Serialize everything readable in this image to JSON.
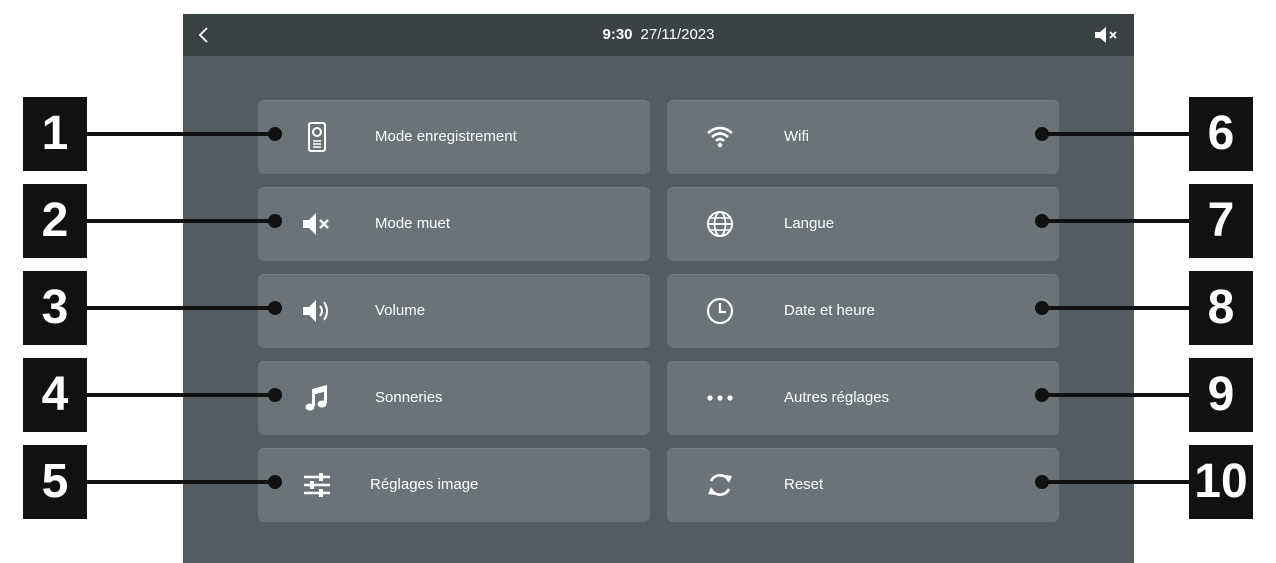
{
  "status": {
    "time": "9:30",
    "date": "27/11/2023"
  },
  "tiles": [
    {
      "label": "Mode enregistrement",
      "icon": "intercom-icon"
    },
    {
      "label": "Mode muet",
      "icon": "mute-icon"
    },
    {
      "label": "Volume",
      "icon": "volume-icon"
    },
    {
      "label": "Sonneries",
      "icon": "music-note-icon"
    },
    {
      "label": "Réglages image",
      "icon": "sliders-icon"
    },
    {
      "label": "Wifi",
      "icon": "wifi-icon"
    },
    {
      "label": "Langue",
      "icon": "globe-icon"
    },
    {
      "label": "Date et heure",
      "icon": "clock-icon"
    },
    {
      "label": "Autres réglages",
      "icon": "more-dots-icon"
    },
    {
      "label": "Reset",
      "icon": "reset-icon"
    }
  ],
  "callouts": [
    "1",
    "2",
    "3",
    "4",
    "5",
    "6",
    "7",
    "8",
    "9",
    "10"
  ],
  "colors": {
    "screen_bg": "#545c61",
    "tile_bg": "#6a7378",
    "status_bar": "#3b4246",
    "callout_bg": "#111111"
  }
}
